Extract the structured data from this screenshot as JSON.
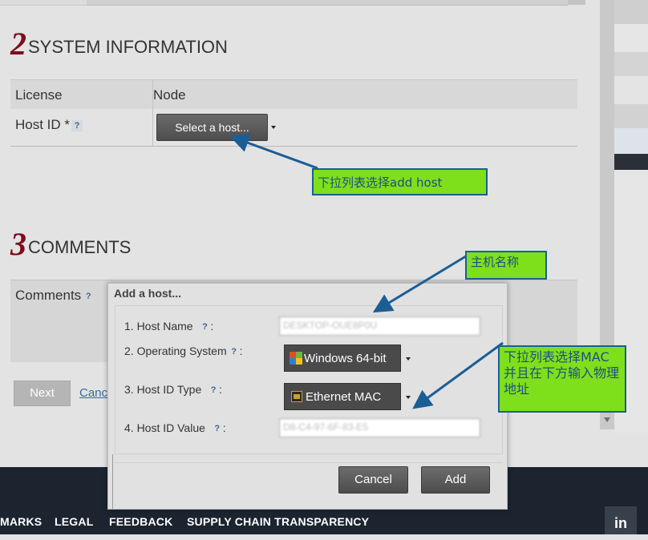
{
  "system_section": {
    "number": "2",
    "title": "SYSTEM INFORMATION",
    "license_label": "License",
    "node_label": "Node",
    "host_id_label": "Host ID *",
    "help_glyph": "?",
    "select_host_label": "Select a host..."
  },
  "comments_section": {
    "number": "3",
    "title": "COMMENTS",
    "comments_label": "Comments",
    "help_glyph": "?"
  },
  "form_actions": {
    "next_label": "Next",
    "cancel_label": "Cance"
  },
  "modal": {
    "title": "Add a host...",
    "host_name_label": "1. Host Name",
    "host_name_value": "DESKTOP-OUE8P0U",
    "os_label": "2. Operating System",
    "os_value": "Windows 64-bit",
    "host_id_type_label": "3. Host ID Type",
    "host_id_type_value": "Ethernet MAC",
    "host_id_value_label": "4. Host ID Value",
    "host_id_value": "D8-C4-97-6F-83-E5",
    "help_glyph": "?",
    "colon": ":",
    "cancel_button": "Cancel",
    "add_button": "Add"
  },
  "annotations": {
    "dropdown_note": "下拉列表选择add host",
    "hostname_note": "主机名称",
    "mac_note": "下拉列表选择MAC并且在下方输入物理地址"
  },
  "footer": {
    "links": [
      "MARKS",
      "LEGAL",
      "FEEDBACK",
      "SUPPLY CHAIN TRANSPARENCY"
    ],
    "linkedin_label": "in"
  },
  "colors": {
    "section_number": "#7d0c1c",
    "callout_fill": "#7ee01a",
    "callout_border": "#1b5e96",
    "footer_bg": "#1c2430"
  },
  "icons": {
    "os": "windows-logo-icon",
    "host_id_type": "ethernet-card-icon",
    "linkedin": "linkedin-icon",
    "dropdown": "caret-down-icon"
  }
}
